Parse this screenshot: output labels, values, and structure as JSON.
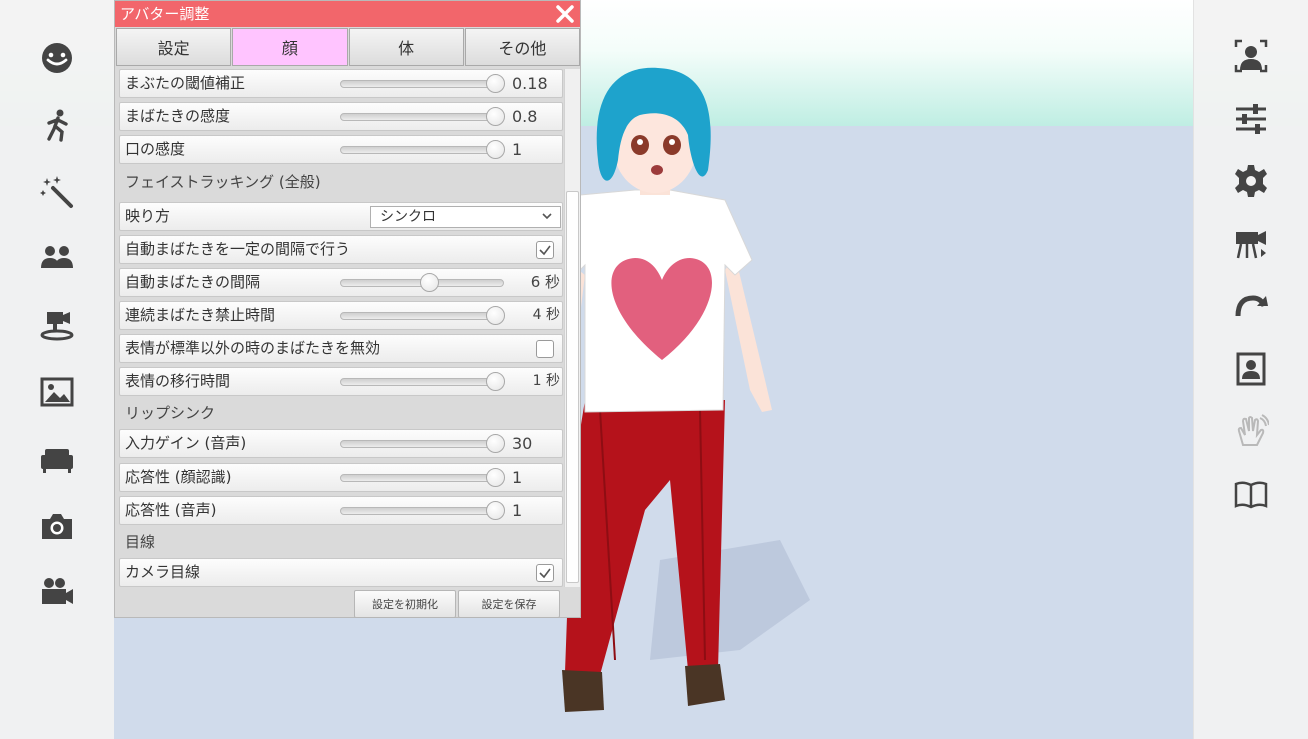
{
  "panel": {
    "title": "アバター調整",
    "tabs": [
      {
        "label": "設定",
        "active": false
      },
      {
        "label": "顔",
        "active": true
      },
      {
        "label": "体",
        "active": false
      },
      {
        "label": "その他",
        "active": false
      }
    ],
    "rows": {
      "eyelid_threshold": {
        "label": "まぶたの閾値補正",
        "value": "0.18",
        "level": 1.0
      },
      "blink_sensitivity": {
        "label": "まばたきの感度",
        "value": "0.8",
        "level": 1.0
      },
      "mouth_sensitivity": {
        "label": "口の感度",
        "value": "1",
        "level": 1.0
      },
      "face_tracking_header": "フェイストラッキング (全般)",
      "display_mode": {
        "label": "映り方",
        "value": "シンクロ"
      },
      "auto_blink": {
        "label": "自動まばたきを一定の間隔で行う",
        "checked": true
      },
      "auto_blink_interval": {
        "label": "自動まばたきの間隔",
        "value": "6 秒",
        "level": 0.55
      },
      "consecutive_blink_ban": {
        "label": "連続まばたき禁止時間",
        "value": "4 秒",
        "level": 1.0
      },
      "disable_blink_non_standard": {
        "label": "表情が標準以外の時のまばたきを無効",
        "checked": false
      },
      "expression_transition": {
        "label": "表情の移行時間",
        "value": "1 秒",
        "level": 1.0
      },
      "lip_sync_header": "リップシンク",
      "input_gain": {
        "label": "入力ゲイン (音声)",
        "value": "30",
        "level": 1.0
      },
      "responsiveness_face": {
        "label": "応答性 (顔認識)",
        "value": "1",
        "level": 1.0
      },
      "responsiveness_voice": {
        "label": "応答性 (音声)",
        "value": "1",
        "level": 1.0
      },
      "gaze_header": "目線",
      "camera_gaze": {
        "label": "カメラ目線",
        "checked": true
      }
    },
    "reset_label": "設定を初期化",
    "save_label": "設定を保存"
  },
  "colors": {
    "title_bar": "#f2666b",
    "active_tab": "#ffc4ff",
    "shirt_heart": "#e2607e",
    "hair": "#1ea3cc",
    "pants": "#b5121b"
  },
  "left_sidebar_icons": [
    "smile-face-icon",
    "running-pose-icon",
    "magic-wand-icon",
    "group-icon",
    "video-camera-stage-icon",
    "image-icon",
    "sofa-icon",
    "camera-icon",
    "movie-camera-icon"
  ],
  "right_sidebar_icons": [
    "face-tracking-icon",
    "sliders-icon",
    "gear-icon",
    "camera-switch-icon",
    "redo-arrow-icon",
    "portrait-frame-icon",
    "hand-wave-icon",
    "open-book-icon"
  ]
}
